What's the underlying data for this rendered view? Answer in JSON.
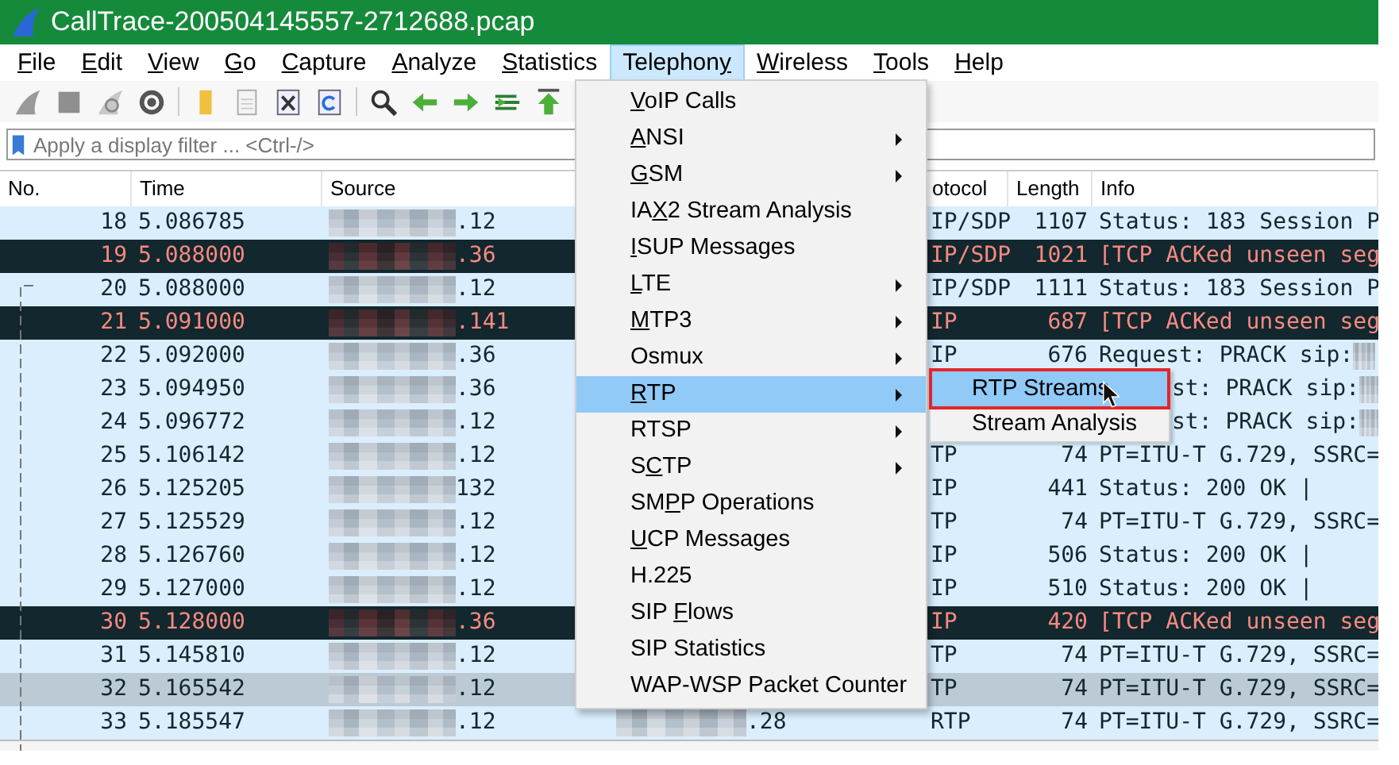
{
  "window": {
    "title": "CallTrace-200504145557-2712688.pcap"
  },
  "menubar": [
    {
      "key": "F",
      "post": "ile",
      "selected": false
    },
    {
      "key": "E",
      "post": "dit",
      "selected": false
    },
    {
      "key": "V",
      "post": "iew",
      "selected": false
    },
    {
      "key": "G",
      "post": "o",
      "selected": false
    },
    {
      "key": "C",
      "post": "apture",
      "selected": false
    },
    {
      "key": "A",
      "post": "nalyze",
      "selected": false
    },
    {
      "key": "S",
      "post": "tatistics",
      "selected": false
    },
    {
      "pre": "Telephon",
      "key": "y",
      "selected": true
    },
    {
      "key": "W",
      "post": "ireless",
      "selected": false
    },
    {
      "key": "T",
      "post": "ools",
      "selected": false
    },
    {
      "key": "H",
      "post": "elp",
      "selected": false
    }
  ],
  "filter": {
    "placeholder": "Apply a display filter ... <Ctrl-/>"
  },
  "table": {
    "columns": [
      {
        "label": "No."
      },
      {
        "label": "Time"
      },
      {
        "label": "Source"
      },
      {},
      {
        "label": "otocol"
      },
      {
        "label": "Length"
      },
      {
        "label": "Info"
      }
    ],
    "rows": [
      {
        "no": "18",
        "time": "5.086785",
        "source": ".12",
        "protocol": "IP/SDP",
        "length": "1107",
        "info": "Status: 183 Session P",
        "kind": "normal",
        "selected": false,
        "info_redacted": false
      },
      {
        "no": "19",
        "time": "5.088000",
        "source": ".36",
        "protocol": "IP/SDP",
        "length": "1021",
        "info": "[TCP ACKed unseen seg",
        "kind": "alert",
        "selected": false,
        "info_redacted": false
      },
      {
        "no": "20",
        "time": "5.088000",
        "source": ".12",
        "protocol": "IP/SDP",
        "length": "1111",
        "info": "Status: 183 Session P",
        "kind": "normal",
        "selected": false,
        "info_redacted": false
      },
      {
        "no": "21",
        "time": "5.091000",
        "source": ".141",
        "protocol": "IP",
        "length": "687",
        "info": "[TCP ACKed unseen seg",
        "kind": "alert",
        "selected": false,
        "info_redacted": false
      },
      {
        "no": "22",
        "time": "5.092000",
        "source": ".36",
        "protocol": "IP",
        "length": "676",
        "info": "Request: PRACK sip:",
        "kind": "normal",
        "selected": false,
        "info_redacted": true
      },
      {
        "no": "23",
        "time": "5.094950",
        "source": ".36",
        "info": "st: PRACK sip:",
        "kind": "normal",
        "selected": false,
        "info_redacted": true
      },
      {
        "no": "24",
        "time": "5.096772",
        "source": ".12",
        "info": "st: PRACK sip:",
        "kind": "normal",
        "selected": false,
        "info_redacted": true
      },
      {
        "no": "25",
        "time": "5.106142",
        "source": ".12",
        "protocol": "TP",
        "length": "74",
        "info": "PT=ITU-T G.729, SSRC=",
        "kind": "normal",
        "selected": false,
        "info_redacted": false
      },
      {
        "no": "26",
        "time": "5.125205",
        "source": "132",
        "protocol": "IP",
        "length": "441",
        "info": "Status: 200 OK |",
        "kind": "normal",
        "selected": false,
        "info_redacted": false
      },
      {
        "no": "27",
        "time": "5.125529",
        "source": ".12",
        "protocol": "TP",
        "length": "74",
        "info": "PT=ITU-T G.729, SSRC=",
        "kind": "normal",
        "selected": false,
        "info_redacted": false
      },
      {
        "no": "28",
        "time": "5.126760",
        "source": ".12",
        "protocol": "IP",
        "length": "506",
        "info": "Status: 200 OK |",
        "kind": "normal",
        "selected": false,
        "info_redacted": false
      },
      {
        "no": "29",
        "time": "5.127000",
        "source": ".12",
        "protocol": "IP",
        "length": "510",
        "info": "Status: 200 OK |",
        "kind": "normal",
        "selected": false,
        "info_redacted": false
      },
      {
        "no": "30",
        "time": "5.128000",
        "source": ".36",
        "protocol": "IP",
        "length": "420",
        "info": "[TCP ACKed unseen seg",
        "kind": "alert",
        "selected": false,
        "info_redacted": false
      },
      {
        "no": "31",
        "time": "5.145810",
        "source": ".12",
        "protocol": "TP",
        "length": "74",
        "info": "PT=ITU-T G.729, SSRC=",
        "kind": "normal",
        "selected": false,
        "info_redacted": false
      },
      {
        "no": "32",
        "time": "5.165542",
        "source": ".12",
        "protocol": "TP",
        "length": "74",
        "info": "PT=ITU-T G.729, SSRC=",
        "kind": "normal",
        "selected": true,
        "info_redacted": false
      },
      {
        "no": "33",
        "time": "5.185547",
        "source": ".12",
        "destination": ".28",
        "protocol": "RTP",
        "length": "74",
        "info": "PT=ITU-T G.729, SSRC=",
        "kind": "normal",
        "selected": false,
        "info_redacted": false
      }
    ]
  },
  "telephony_menu": [
    {
      "key": "V",
      "post": "oIP Calls",
      "submenu": false,
      "selected": false
    },
    {
      "key": "A",
      "post": "NSI",
      "submenu": true,
      "selected": false
    },
    {
      "key": "G",
      "post": "SM",
      "submenu": true,
      "selected": false
    },
    {
      "pre": "IA",
      "key": "X",
      "post": "2 Stream Analysis",
      "submenu": false,
      "selected": false
    },
    {
      "key": "I",
      "post": "SUP Messages",
      "submenu": false,
      "selected": false
    },
    {
      "key": "L",
      "post": "TE",
      "submenu": true,
      "selected": false
    },
    {
      "key": "M",
      "post": "TP3",
      "submenu": true,
      "selected": false
    },
    {
      "pre": "Osmux",
      "submenu": true,
      "selected": false
    },
    {
      "key": "R",
      "post": "TP",
      "submenu": true,
      "selected": true
    },
    {
      "pre": "RTSP",
      "submenu": true,
      "selected": false
    },
    {
      "pre": "S",
      "key": "C",
      "post": "TP",
      "submenu": true,
      "selected": false
    },
    {
      "pre": "SM",
      "key": "P",
      "post": "P Operations",
      "submenu": false,
      "selected": false
    },
    {
      "key": "U",
      "post": "CP Messages",
      "submenu": false,
      "selected": false
    },
    {
      "pre": "H.225",
      "submenu": false,
      "selected": false
    },
    {
      "pre": "SIP ",
      "key": "F",
      "post": "lows",
      "submenu": false,
      "selected": false
    },
    {
      "pre": "SIP Statistics",
      "submenu": false,
      "selected": false
    },
    {
      "pre": "WAP-WSP Packet Counter",
      "submenu": false,
      "selected": false
    }
  ],
  "rtp_submenu": [
    {
      "label": "RTP Streams",
      "selected": true,
      "annotated": true
    },
    {
      "label": "Stream Analysis",
      "selected": false,
      "annotated": false
    }
  ]
}
